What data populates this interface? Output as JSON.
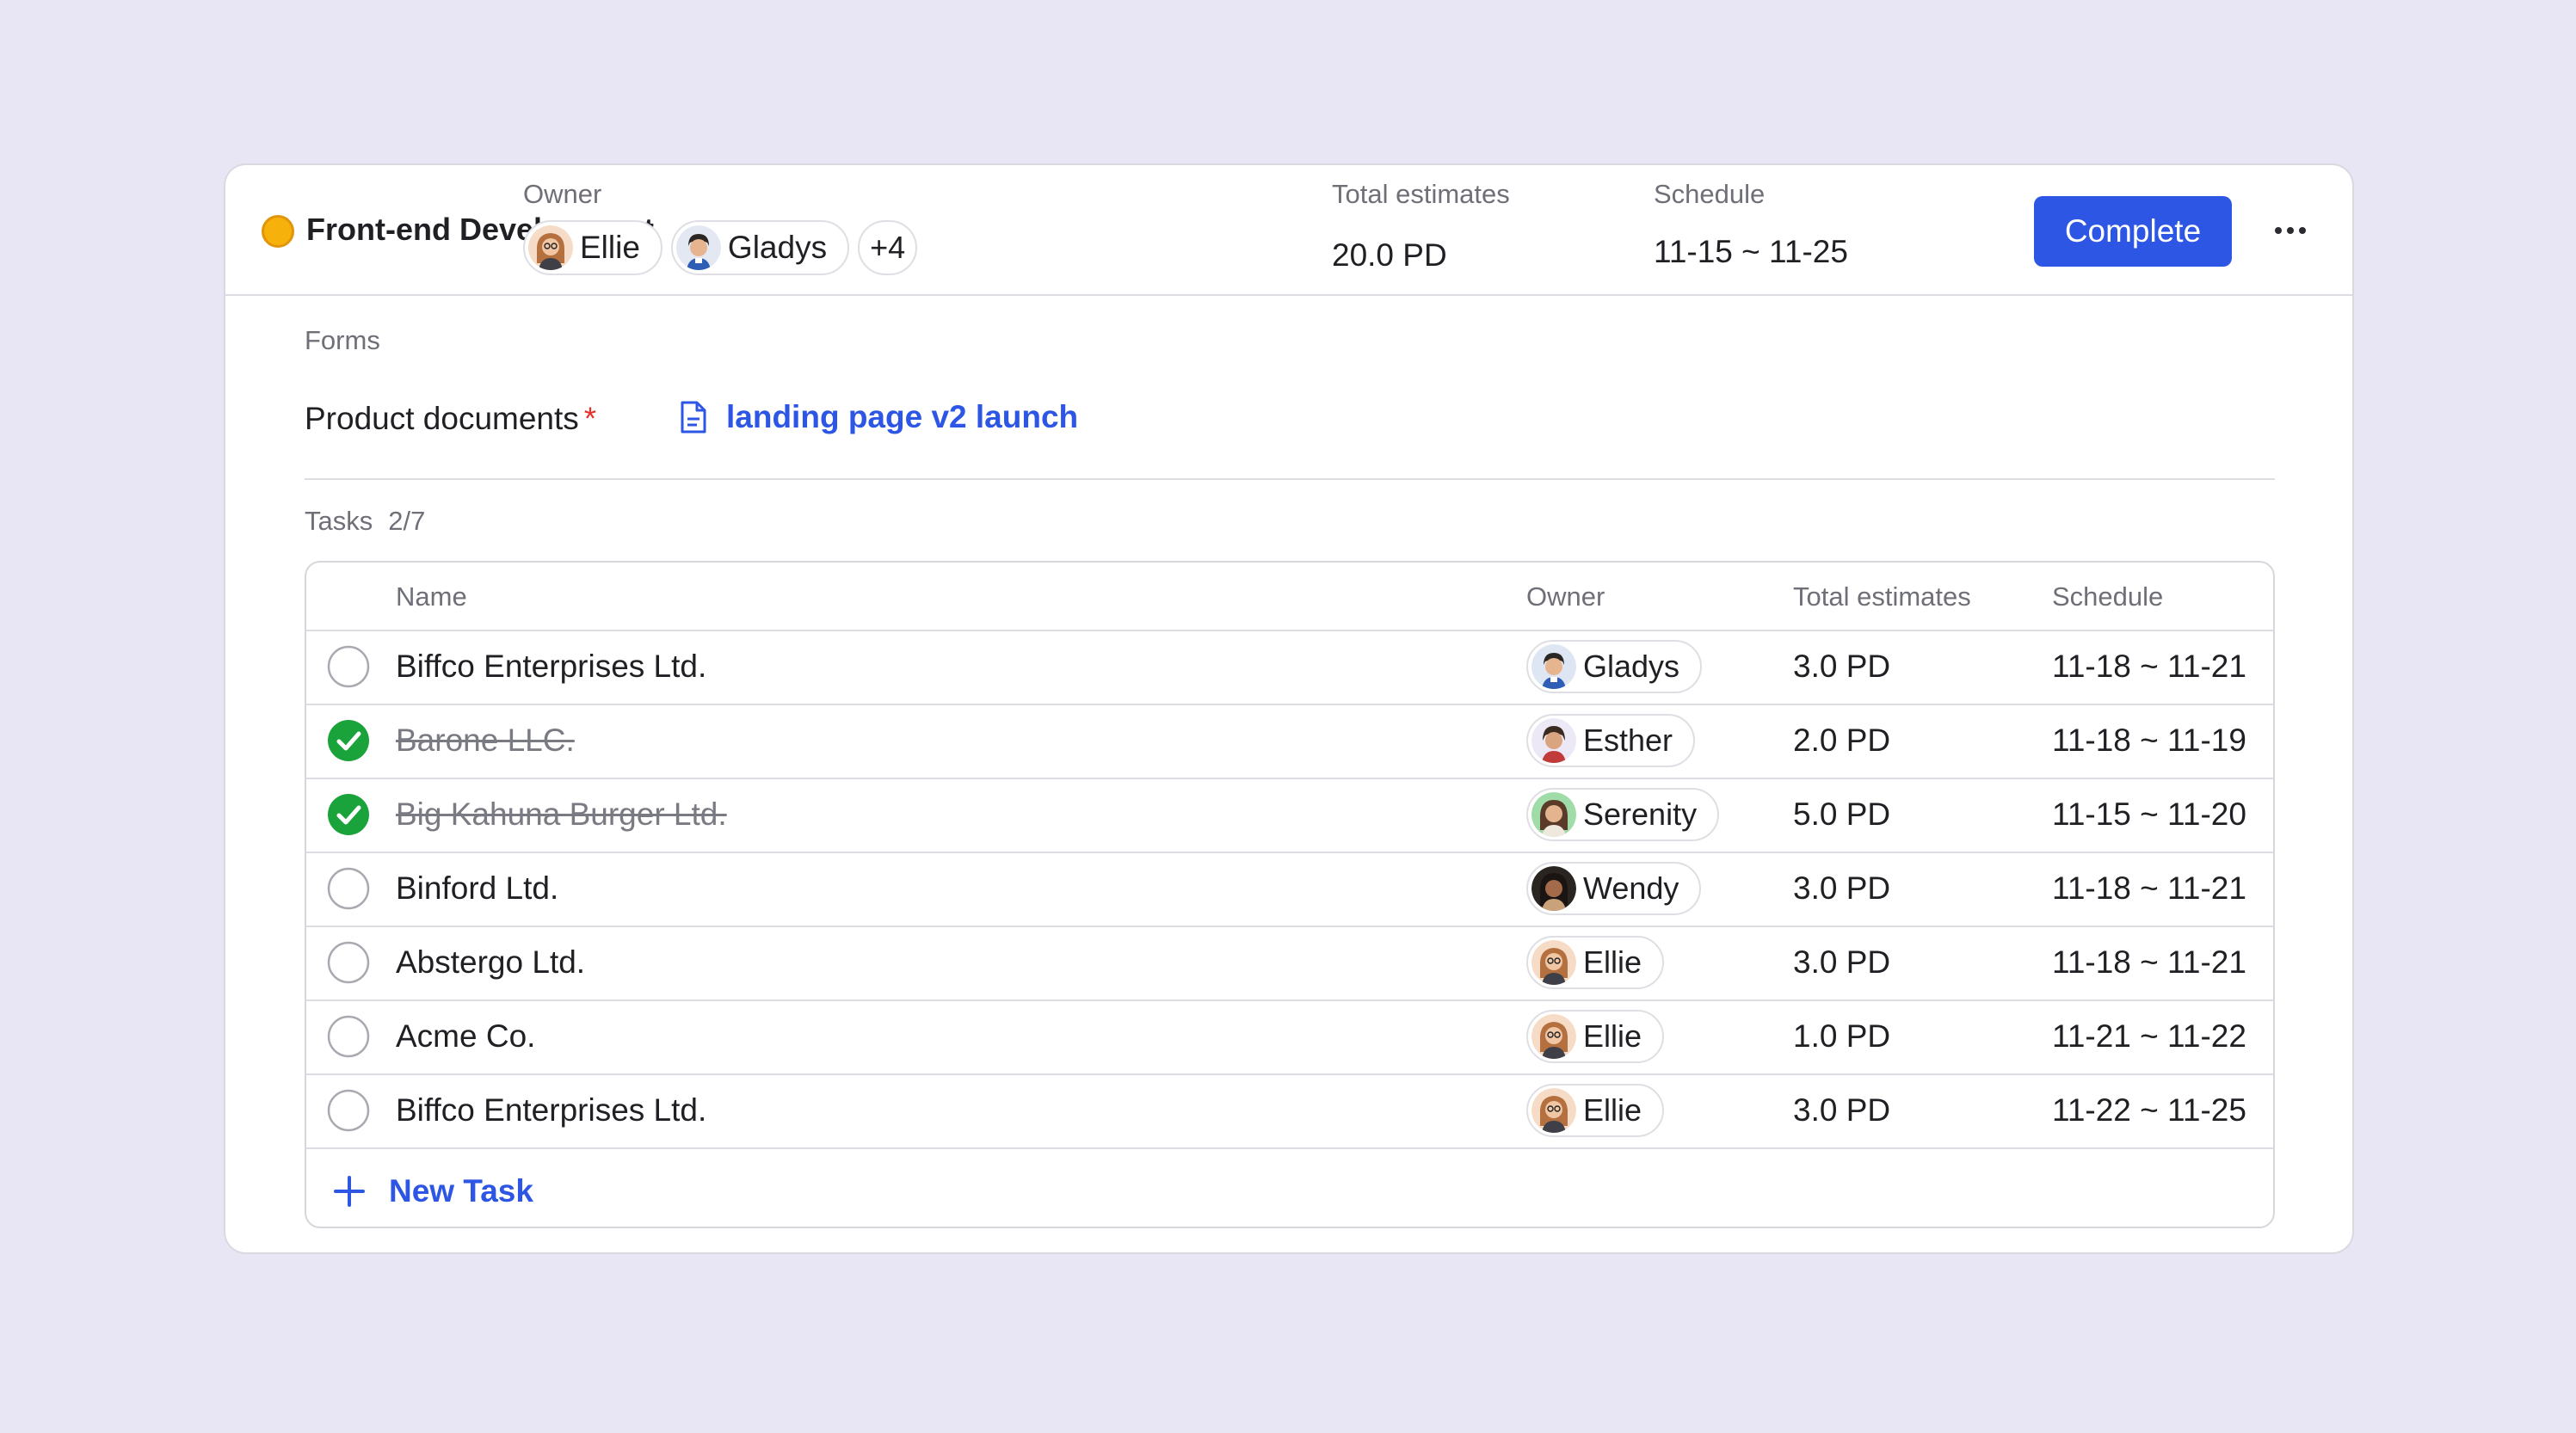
{
  "project": {
    "title": "Front-end Development",
    "status_color": "#f6b10a",
    "owner_label": "Owner",
    "owners": [
      {
        "name": "Ellie",
        "avatar": "avatar-ellie"
      },
      {
        "name": "Gladys",
        "avatar": "avatar-gladys"
      }
    ],
    "more_owners": "+4",
    "estimates_label": "Total estimates",
    "estimates_value": "20.0 PD",
    "schedule_label": "Schedule",
    "schedule_value": "11-15 ~ 11-25",
    "complete_label": "Complete",
    "more_icon": "more-horizontal-icon"
  },
  "forms": {
    "label": "Forms",
    "doc_label": "Product documents",
    "required_mark": "*",
    "doc_icon": "document-icon",
    "doc_link": "landing page v2 launch"
  },
  "tasks": {
    "label": "Tasks",
    "count": "2/7",
    "columns": {
      "name": "Name",
      "owner": "Owner",
      "estimates": "Total estimates",
      "schedule": "Schedule"
    },
    "rows": [
      {
        "name": "Biffco Enterprises Ltd.",
        "done": false,
        "owner": "Gladys",
        "estimate": "3.0 PD",
        "schedule": "11-18 ~ 11-21"
      },
      {
        "name": "Barone LLC.",
        "done": true,
        "owner": "Esther",
        "estimate": "2.0 PD",
        "schedule": "11-18 ~ 11-19"
      },
      {
        "name": "Big Kahuna Burger Ltd.",
        "done": true,
        "owner": "Serenity",
        "estimate": "5.0 PD",
        "schedule": "11-15 ~ 11-20"
      },
      {
        "name": "Binford Ltd.",
        "done": false,
        "owner": "Wendy",
        "estimate": "3.0 PD",
        "schedule": "11-18 ~ 11-21"
      },
      {
        "name": "Abstergo Ltd.",
        "done": false,
        "owner": "Ellie",
        "estimate": "3.0 PD",
        "schedule": "11-18 ~ 11-21"
      },
      {
        "name": "Acme Co.",
        "done": false,
        "owner": "Ellie",
        "estimate": "1.0 PD",
        "schedule": "11-21 ~ 11-22"
      },
      {
        "name": "Biffco Enterprises Ltd.",
        "done": false,
        "owner": "Ellie",
        "estimate": "3.0 PD",
        "schedule": "11-22 ~ 11-25"
      }
    ],
    "new_task_label": "New Task",
    "new_task_icon": "plus-icon"
  },
  "colors": {
    "accent": "#2d56e5",
    "done_check": "#1aa33a",
    "required": "#e5322b"
  }
}
